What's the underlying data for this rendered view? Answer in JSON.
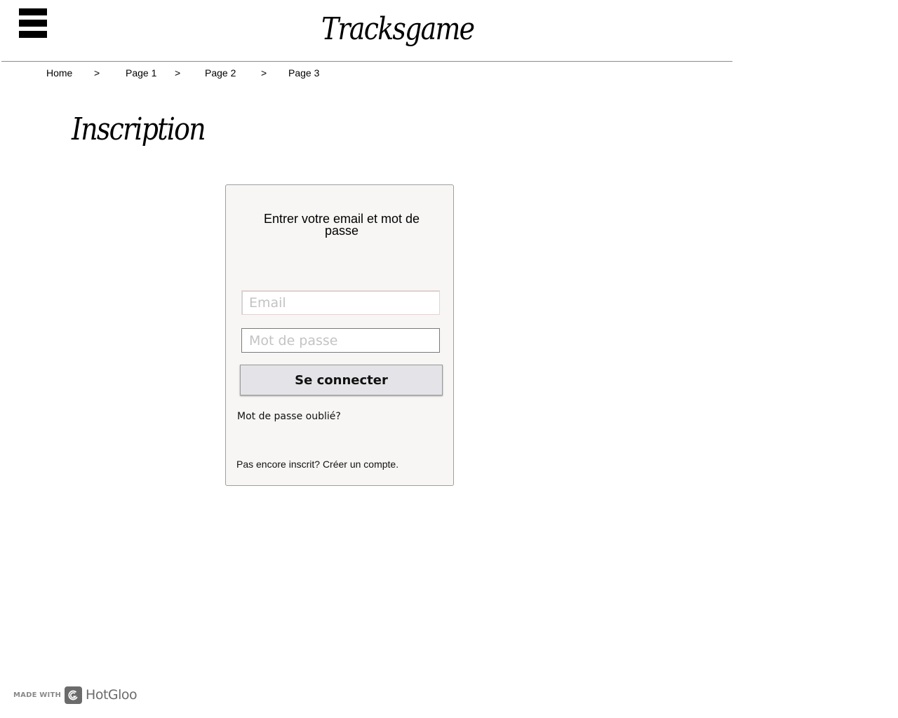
{
  "header": {
    "site_title": "Tracksgame",
    "menu_icon": "hamburger-menu-icon"
  },
  "breadcrumb": {
    "items": [
      "Home",
      "Page 1",
      "Page 2",
      "Page 3"
    ],
    "separator": ">"
  },
  "page": {
    "heading": "Inscription"
  },
  "login": {
    "prompt": "Entrer votre email et mot de passe",
    "email_placeholder": "Email",
    "email_value": "",
    "password_placeholder": "Mot de passe",
    "password_value": "",
    "submit_label": "Se connecter",
    "forgot_label": "Mot de passe oublié?",
    "signup_label": "Pas encore inscrit? Créer un compte."
  },
  "footer": {
    "made_with": "MADE WITH",
    "brand": "HotGloo",
    "brand_icon": "hotgloo-logo-icon"
  },
  "colors": {
    "panel_background": "#f7f6f4",
    "button_background": "#e4e4e8",
    "placeholder": "#c3c3c3"
  }
}
